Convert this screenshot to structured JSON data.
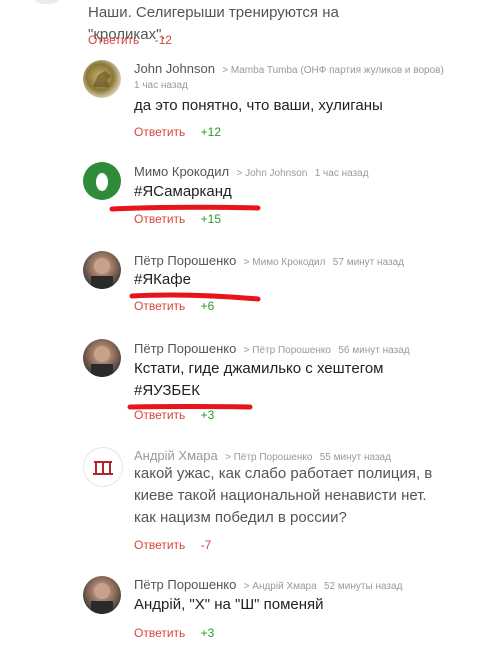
{
  "top": {
    "text": "Наши. Селигерыши тренируются на \"кроликах\".",
    "reply_label": "Ответить",
    "score": "-12"
  },
  "comments": [
    {
      "author": "John Johnson",
      "reply_to": "> Mamba Tumba (ОНФ партия жуликов и воров)",
      "time": "1 час назад",
      "text": "да это понятно, что ваши, хулиганы",
      "reply_label": "Ответить",
      "score": "+12"
    },
    {
      "author": "Мимо Крокодил",
      "reply_to": "> John Johnson",
      "time": "1 час назад",
      "text": "#ЯСамарканд",
      "reply_label": "Ответить",
      "score": "+15"
    },
    {
      "author": "Пётр Порошенко",
      "reply_to": "> Мимо Крокодил",
      "time": "57 минут назад",
      "text": "#ЯКафе",
      "reply_label": "Ответить",
      "score": "+6"
    },
    {
      "author": "Пётр Порошенко",
      "reply_to": "> Пётр Порошенко",
      "time": "56 минут назад",
      "text_line1": "Кстати, гиде джамилько с хештегом",
      "text_line2": "#ЯУЗБЕК",
      "reply_label": "Ответить",
      "score": "+3"
    },
    {
      "author": "Андрій Хмара",
      "reply_to": "> Пётр Порошенко",
      "time": "55 минут назад",
      "text_line1": "какой ужас, как слабо работает полиция, в",
      "text_line2": "киеве такой национальной ненависти нет.",
      "text_line3": "как нацизм победил в россии?",
      "reply_label": "Ответить",
      "score": "-7"
    },
    {
      "author": "Пётр Порошенко",
      "reply_to": "> Андрій Хмара",
      "time": "52 минуты назад",
      "text": "Андрій, \"Х\" на \"Ш\" поменяй",
      "reply_label": "Ответить",
      "score": "+3"
    }
  ],
  "colors": {
    "reply": "#d6453e",
    "positive": "#2a9a2a",
    "negative": "#d6453e",
    "highlight": "#e8141c"
  }
}
